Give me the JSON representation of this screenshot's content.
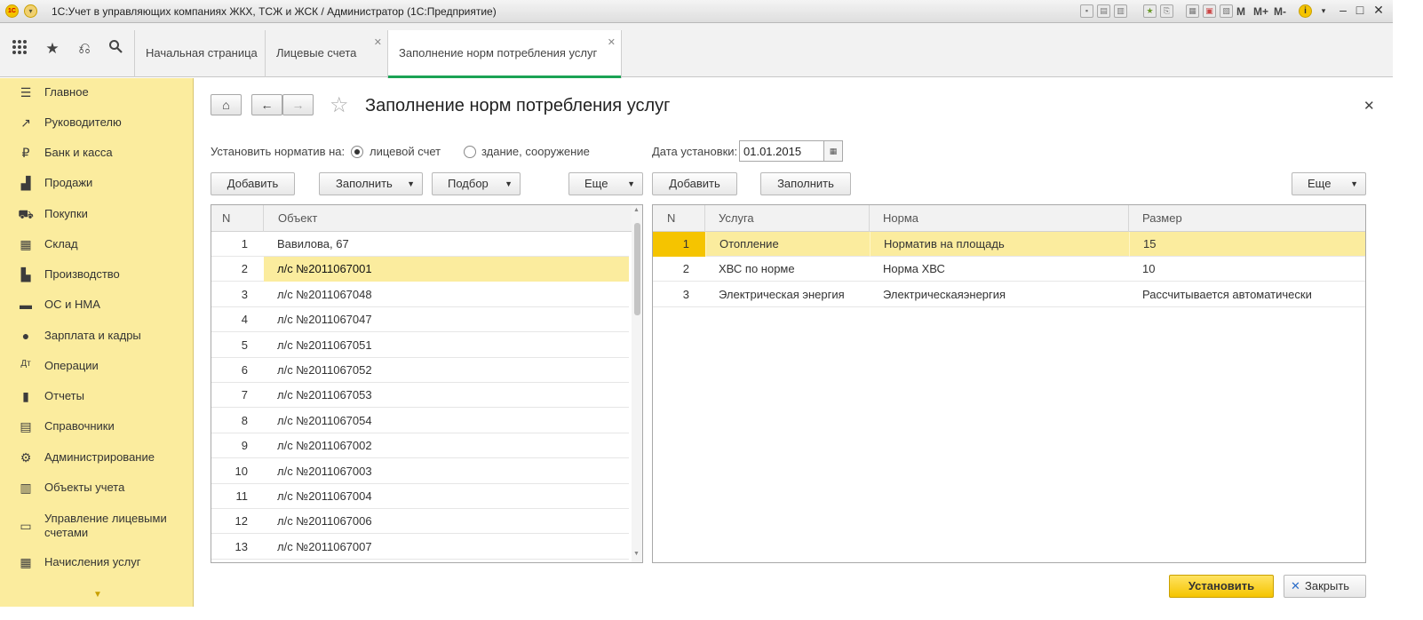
{
  "window": {
    "title": "1С:Учет в управляющих компаниях ЖКХ, ТСЖ и ЖСК / Администратор  (1С:Предприятие)",
    "m_buttons": [
      "M",
      "M+",
      "M-"
    ]
  },
  "tabs": [
    {
      "label": "Начальная страница"
    },
    {
      "label": "Лицевые счета"
    },
    {
      "label": "Заполнение норм потребления услуг"
    }
  ],
  "sidebar": {
    "items": [
      {
        "label": "Главное",
        "icon": "list-icon"
      },
      {
        "label": "Руководителю",
        "icon": "trend-icon"
      },
      {
        "label": "Банк и касса",
        "icon": "ruble-icon"
      },
      {
        "label": "Продажи",
        "icon": "bag-icon"
      },
      {
        "label": "Покупки",
        "icon": "cart-icon"
      },
      {
        "label": "Склад",
        "icon": "warehouse-icon"
      },
      {
        "label": "Производство",
        "icon": "factory-icon"
      },
      {
        "label": "ОС и НМА",
        "icon": "truck-icon"
      },
      {
        "label": "Зарплата и кадры",
        "icon": "person-icon"
      },
      {
        "label": "Операции",
        "icon": "dt-kt-icon"
      },
      {
        "label": "Отчеты",
        "icon": "bar-chart-icon"
      },
      {
        "label": "Справочники",
        "icon": "book-icon"
      },
      {
        "label": "Администрирование",
        "icon": "gear-icon"
      },
      {
        "label": "Объекты учета",
        "icon": "grid-icon"
      },
      {
        "label": "Управление лицевыми счетами",
        "icon": "card-icon"
      },
      {
        "label": "Начисления услуг",
        "icon": "calculator-icon"
      }
    ]
  },
  "form": {
    "title": "Заполнение норм потребления услуг",
    "set_norm_label": "Установить норматив на:",
    "radio_account": "лицевой счет",
    "radio_building": "здание, сооружение",
    "radio_selected": "лицевой счет",
    "date_label": "Дата установки:",
    "date_value": "01.01.2015",
    "left_buttons": {
      "add": "Добавить",
      "fill": "Заполнить",
      "pick": "Подбор",
      "more": "Еще"
    },
    "right_buttons": {
      "add": "Добавить",
      "fill": "Заполнить",
      "more": "Еще"
    },
    "left_table": {
      "headers": [
        "N",
        "Объект"
      ],
      "selected_row": 2,
      "rows": [
        {
          "n": "1",
          "object": "Вавилова, 67"
        },
        {
          "n": "2",
          "object": "л/с №2011067001"
        },
        {
          "n": "3",
          "object": "л/с №2011067048"
        },
        {
          "n": "4",
          "object": "л/с №2011067047"
        },
        {
          "n": "5",
          "object": "л/с №2011067051"
        },
        {
          "n": "6",
          "object": "л/с №2011067052"
        },
        {
          "n": "7",
          "object": "л/с №2011067053"
        },
        {
          "n": "8",
          "object": "л/с №2011067054"
        },
        {
          "n": "9",
          "object": "л/с №2011067002"
        },
        {
          "n": "10",
          "object": "л/с №2011067003"
        },
        {
          "n": "11",
          "object": "л/с №2011067004"
        },
        {
          "n": "12",
          "object": "л/с №2011067006"
        },
        {
          "n": "13",
          "object": "л/с №2011067007"
        }
      ]
    },
    "right_table": {
      "headers": [
        "N",
        "Услуга",
        "Норма",
        "Размер"
      ],
      "selected_row": 1,
      "rows": [
        {
          "n": "1",
          "service": "Отопление",
          "norm": "Норматив на площадь",
          "size": "15"
        },
        {
          "n": "2",
          "service": "ХВС по норме",
          "norm": "Норма ХВС",
          "size": "10"
        },
        {
          "n": "3",
          "service": "Электрическая энергия",
          "norm": "Электрическаяэнергия",
          "size": "Рассчитывается автоматически"
        }
      ]
    },
    "set_button": "Установить",
    "close_button": "Закрыть"
  }
}
